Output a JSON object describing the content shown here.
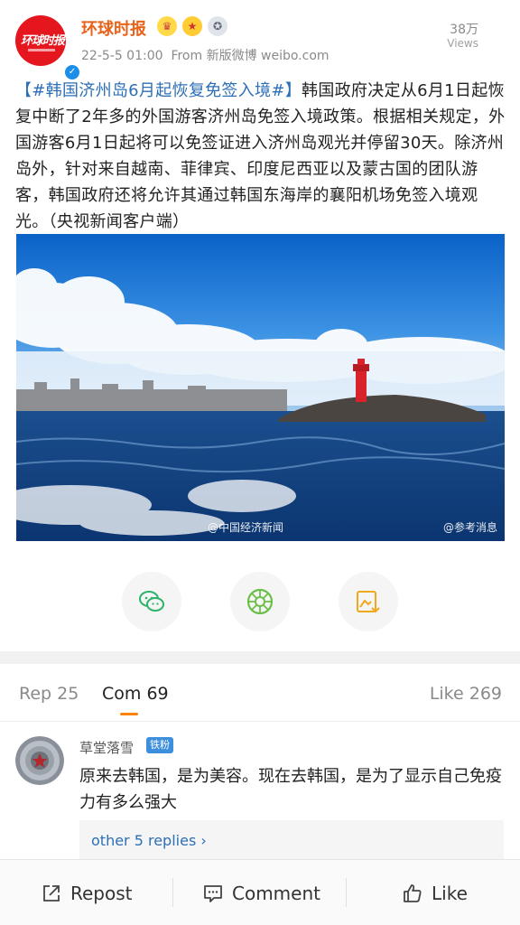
{
  "header": {
    "author": "环球时报",
    "avatar_logo_text": "环球时报",
    "time": "22-5-5 01:00",
    "source": "From 新版微博 weibo.com",
    "views_count": "38万",
    "views_label": "Views",
    "badges": [
      "crown-badge-icon",
      "star-badge-icon",
      "medal-badge-icon"
    ]
  },
  "post": {
    "hashtag": "【#韩国济州岛6月起恢复免签入境#】",
    "body": "韩国政府决定从6月1日起恢复中断了2年多的外国游客济州岛免签入境政策。根据相关规定，外国游客6月1日起将可以免签证进入济州岛观光并停留30天。除济州岛外，针对来自越南、菲律宾、印度尼西亚以及蒙古国的团队游客，韩国政府还将允许其通过韩国东海岸的襄阳机场免签入境观光。（央视新闻客户端）"
  },
  "photo": {
    "watermark_left": "@中国经济新闻",
    "watermark_right": "@参考消息"
  },
  "share": {
    "icons": [
      "wechat-icon",
      "moments-icon",
      "save-image-icon"
    ]
  },
  "tabs": {
    "repost": "Rep 25",
    "comment": "Com 69",
    "like": "Like 269"
  },
  "comment": {
    "user": "草堂落雪",
    "fan_badge": "铁粉",
    "text": "原来去韩国，是为美容。现在去韩国，是为了显示自己免疫力有多么强大",
    "replies_label": "other 5 replies ›"
  },
  "bottom_bar": {
    "repost": "Repost",
    "comment": "Comment",
    "like": "Like"
  },
  "colors": {
    "author": "#e8621a",
    "link": "#2d6fb6",
    "tab_accent": "#ff8200",
    "brand_red": "#e5161e",
    "verify_blue": "#1d8dea"
  }
}
